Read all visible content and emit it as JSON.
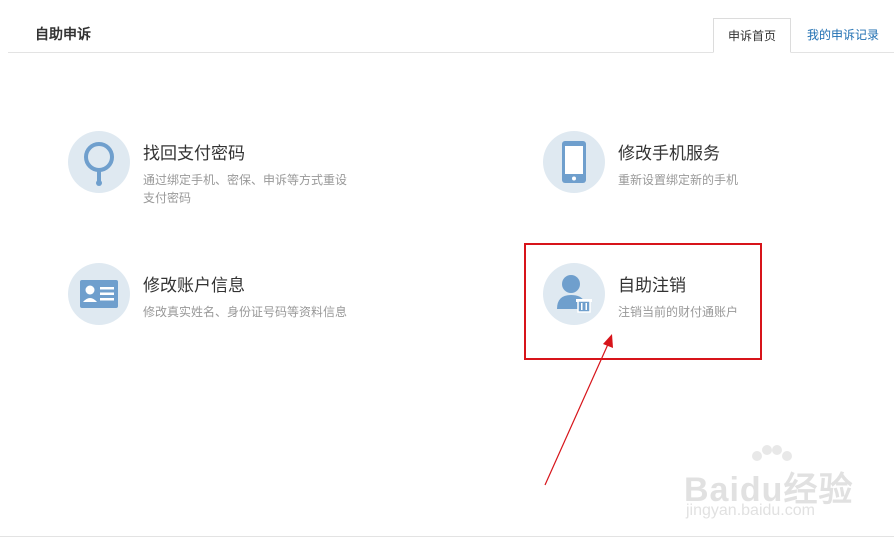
{
  "header": {
    "title": "自助申诉",
    "tabs": [
      {
        "label": "申诉首页",
        "active": true
      },
      {
        "label": "我的申诉记录",
        "active": false
      }
    ]
  },
  "cards": [
    {
      "title": "找回支付密码",
      "desc": "通过绑定手机、密保、申诉等方式重设支付密码",
      "icon": "magnifier-key-icon"
    },
    {
      "title": "修改手机服务",
      "desc": "重新设置绑定新的手机",
      "icon": "mobile-phone-icon"
    },
    {
      "title": "修改账户信息",
      "desc": "修改真实姓名、身份证号码等资料信息",
      "icon": "id-card-icon"
    },
    {
      "title": "自助注销",
      "desc": "注销当前的财付通账户",
      "icon": "user-delete-icon"
    }
  ],
  "watermark": {
    "brand": "Baidu经验",
    "url": "jingyan.baidu.com"
  },
  "colors": {
    "accent": "#1f6fb2",
    "icon_bg": "#dfe9f1",
    "icon_fg": "#6f9fcd",
    "highlight": "#d7141a"
  }
}
